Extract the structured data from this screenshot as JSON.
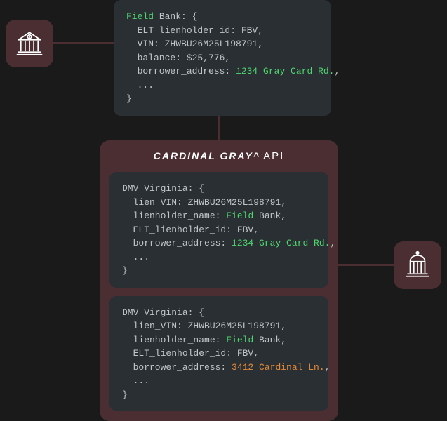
{
  "top_code": {
    "line1_hl": "Field",
    "line1_rest": " Bank: {",
    "line2": "  ELT_lienholder_id: FBV,",
    "line3": "  VIN: ZHWBU26M25L198791,",
    "line4": "  balance: $25,776,",
    "line5_prefix": "  borrower_address: ",
    "line5_addr": "1234 Gray Card Rd.",
    "line5_suffix": ",",
    "line6": "  ...",
    "line7": "}"
  },
  "api": {
    "brand": "CARDINAL GRAY^",
    "label": "API",
    "block1": {
      "line1": "DMV_Virginia: {",
      "line2": "  lien_VIN: ZHWBU26M25L198791,",
      "line3_prefix": "  lienholder_name: ",
      "line3_hl": "Field",
      "line3_rest": " Bank,",
      "line4": "  ELT_lienholder_id: FBV,",
      "line5_prefix": "  borrower_address: ",
      "line5_addr": "1234 Gray Card Rd.",
      "line5_suffix": ",",
      "line6": "  ...",
      "line7": "}"
    },
    "block2": {
      "line1": "DMV_Virginia: {",
      "line2": "  lien_VIN: ZHWBU26M25L198791,",
      "line3_prefix": "  lienholder_name: ",
      "line3_hl": "Field",
      "line3_rest": " Bank,",
      "line4": "  ELT_lienholder_id: FBV,",
      "line5_prefix": "  borrower_address: ",
      "line5_addr": "3412 Cardinal Ln.",
      "line5_suffix": ",",
      "line6": "  ...",
      "line7": "}"
    }
  }
}
